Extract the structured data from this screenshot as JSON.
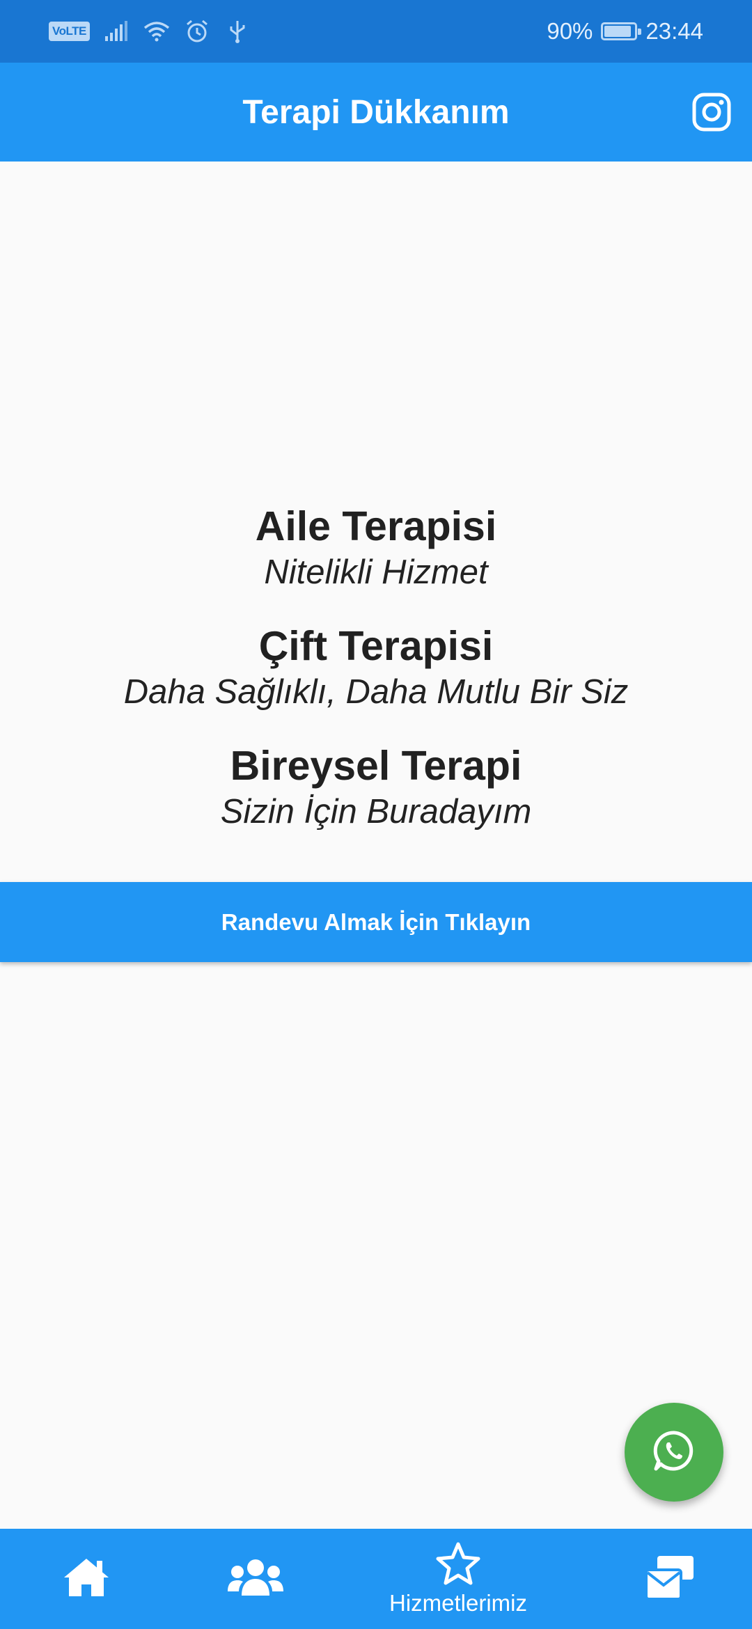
{
  "status_bar": {
    "network_badge": "VoLTE",
    "battery": "90%",
    "battery_level": 0.9,
    "time": "23:44",
    "icons": [
      "signal-icon",
      "wifi-icon",
      "alarm-icon",
      "usb-icon",
      "battery-icon"
    ]
  },
  "app_bar": {
    "title": "Terapi Dükkanım",
    "action_icon": "instagram-icon"
  },
  "services": [
    {
      "title": "Aile Terapisi",
      "subtitle": "Nitelikli Hizmet"
    },
    {
      "title": "Çift Terapisi",
      "subtitle": "Daha Sağlıklı, Daha Mutlu Bir Siz"
    },
    {
      "title": "Bireysel Terapi",
      "subtitle": "Sizin İçin Buradayım"
    }
  ],
  "cta": {
    "label": "Randevu Almak İçin Tıklayın"
  },
  "fab": {
    "icon": "whatsapp-icon"
  },
  "bottom_nav": {
    "items": [
      {
        "icon": "home-icon",
        "label": ""
      },
      {
        "icon": "users-icon",
        "label": ""
      },
      {
        "icon": "star-icon",
        "label": "Hizmetlerimiz",
        "selected": true
      },
      {
        "icon": "mail-icon",
        "label": ""
      }
    ]
  },
  "colors": {
    "primary": "#2196F3",
    "status_bar": "#1976D2",
    "fab": "#4CAF50",
    "background": "#FAFAFA"
  }
}
